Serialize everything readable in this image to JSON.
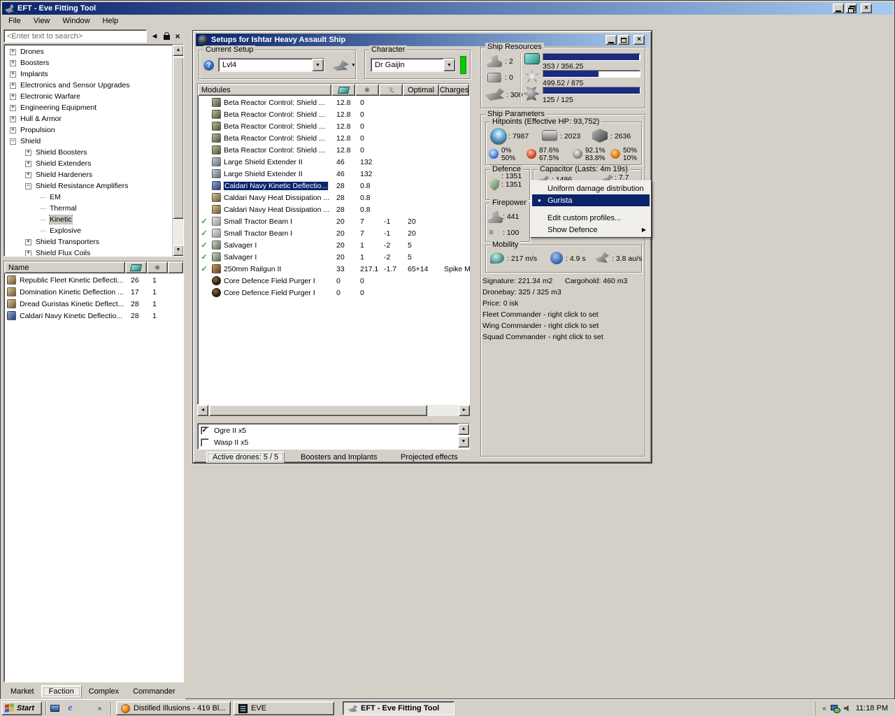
{
  "colors": {
    "title_gradient_start": "#0a246a",
    "title_gradient_end": "#a6caf0",
    "selection": "#0a246a",
    "window_face": "#d4d0c8",
    "mdi_background": "#868686",
    "progress_bar": "#1b2c7e",
    "check_green": "#2f9e2f",
    "character_bar_green": "#00cc00"
  },
  "app": {
    "title": "EFT - Eve Fitting Tool",
    "menu": [
      "File",
      "View",
      "Window",
      "Help"
    ],
    "search_placeholder": "<Enter text to search>"
  },
  "tree": [
    {
      "label": "Drones",
      "glyph": "+",
      "level": 0
    },
    {
      "label": "Boosters",
      "glyph": "+",
      "level": 0
    },
    {
      "label": "Implants",
      "glyph": "+",
      "level": 0
    },
    {
      "label": "Electronics and Sensor Upgrades",
      "glyph": "+",
      "level": 0
    },
    {
      "label": "Electronic Warfare",
      "glyph": "+",
      "level": 0
    },
    {
      "label": "Engineering Equipment",
      "glyph": "+",
      "level": 0
    },
    {
      "label": "Hull & Armor",
      "glyph": "+",
      "level": 0
    },
    {
      "label": "Propulsion",
      "glyph": "+",
      "level": 0
    },
    {
      "label": "Shield",
      "glyph": "-",
      "level": 0
    },
    {
      "label": "Shield Boosters",
      "glyph": "+",
      "level": 1
    },
    {
      "label": "Shield Extenders",
      "glyph": "+",
      "level": 1
    },
    {
      "label": "Shield Hardeners",
      "glyph": "+",
      "level": 1
    },
    {
      "label": "Shield Resistance Amplifiers",
      "glyph": "-",
      "level": 1
    },
    {
      "label": "EM",
      "glyph": "",
      "level": 2
    },
    {
      "label": "Thermal",
      "glyph": "",
      "level": 2
    },
    {
      "label": "Kinetic",
      "glyph": "",
      "level": 2,
      "selected": true
    },
    {
      "label": "Explosive",
      "glyph": "",
      "level": 2
    },
    {
      "label": "Shield Transporters",
      "glyph": "+",
      "level": 1
    },
    {
      "label": "Shield Flux Coils",
      "glyph": "+",
      "level": 1
    }
  ],
  "browser": {
    "name_header": "Name",
    "rows": [
      {
        "name": "Republic Fleet Kinetic Deflecti...",
        "cpu": "26",
        "pg": "1",
        "icon": "module-brown"
      },
      {
        "name": "Domination Kinetic Deflection ...",
        "cpu": "17",
        "pg": "1",
        "icon": "module-brown"
      },
      {
        "name": "Dread Guristas Kinetic Deflect...",
        "cpu": "28",
        "pg": "1",
        "icon": "module-brown"
      },
      {
        "name": "Caldari Navy Kinetic Deflectio...",
        "cpu": "28",
        "pg": "1",
        "icon": "module-blue"
      }
    ]
  },
  "left_tabs": [
    {
      "label": "Market"
    },
    {
      "label": "Faction",
      "selected": true
    },
    {
      "label": "Complex"
    },
    {
      "label": "Commander"
    }
  ],
  "setups": {
    "title": "Setups for Ishtar Heavy Assault Ship",
    "current_setup_label": "Current Setup",
    "current_setup_value": "Lvl4",
    "character_label": "Character",
    "character_value": "Dr Gaijin",
    "columns": {
      "modules": "Modules",
      "optimal": "Optimal",
      "charges": "Charges"
    },
    "modules": [
      {
        "name": "Beta Reactor Control: Shield ...",
        "cpu": "12.8",
        "pg": "0",
        "icon": "reactor"
      },
      {
        "name": "Beta Reactor Control: Shield ...",
        "cpu": "12.8",
        "pg": "0",
        "icon": "reactor"
      },
      {
        "name": "Beta Reactor Control: Shield ...",
        "cpu": "12.8",
        "pg": "0",
        "icon": "reactor"
      },
      {
        "name": "Beta Reactor Control: Shield ...",
        "cpu": "12.8",
        "pg": "0",
        "icon": "reactor"
      },
      {
        "name": "Beta Reactor Control: Shield ...",
        "cpu": "12.8",
        "pg": "0",
        "icon": "reactor"
      },
      {
        "name": "Large Shield Extender II",
        "cpu": "46",
        "pg": "132",
        "icon": "extender"
      },
      {
        "name": "Large Shield Extender II",
        "cpu": "46",
        "pg": "132",
        "icon": "extender"
      },
      {
        "name": "Caldari Navy Kinetic Deflectio...",
        "cpu": "28",
        "pg": "0.8",
        "icon": "hardener-blue",
        "selected": true
      },
      {
        "name": "Caldari Navy Heat Dissipation ...",
        "cpu": "28",
        "pg": "0.8",
        "icon": "hardener-tan"
      },
      {
        "name": "Caldari Navy Heat Dissipation ...",
        "cpu": "28",
        "pg": "0.8",
        "icon": "hardener-tan"
      },
      {
        "name": "Small Tractor Beam I",
        "cpu": "20",
        "pg": "7",
        "cap": "-1",
        "optimal": "20",
        "icon": "tractor",
        "check": true
      },
      {
        "name": "Small Tractor Beam I",
        "cpu": "20",
        "pg": "7",
        "cap": "-1",
        "optimal": "20",
        "icon": "tractor",
        "check": true
      },
      {
        "name": "Salvager I",
        "cpu": "20",
        "pg": "1",
        "cap": "-2",
        "optimal": "5",
        "icon": "salvager",
        "check": true
      },
      {
        "name": "Salvager I",
        "cpu": "20",
        "pg": "1",
        "cap": "-2",
        "optimal": "5",
        "icon": "salvager",
        "check": true
      },
      {
        "name": "250mm Railgun II",
        "cpu": "33",
        "pg": "217.1",
        "cap": "-1.7",
        "optimal": "65+14",
        "charges": "Spike M",
        "icon": "railgun",
        "check": true
      },
      {
        "name": "Core Defence Field Purger I",
        "cpu": "0",
        "pg": "0",
        "icon": "rig"
      },
      {
        "name": "Core Defence Field Purger I",
        "cpu": "0",
        "pg": "0",
        "icon": "rig"
      }
    ],
    "drones": [
      {
        "label": "Ogre II x5",
        "checked": true
      },
      {
        "label": "Wasp II x5",
        "checked": false
      }
    ],
    "bottom_tabs": [
      {
        "label": "Active drones: 5 / 5",
        "selected": true
      },
      {
        "label": "Boosters and Implants"
      },
      {
        "label": "Projected effects"
      }
    ]
  },
  "resources": {
    "group_label": "Ship Resources",
    "turrets": ": 2",
    "launchers": ": 0",
    "calibration": ": 300",
    "cpu": {
      "text": "353 / 356.25",
      "pct": 99
    },
    "powergrid": {
      "text": "499.52 / 875",
      "pct": 57
    },
    "drone_bandwidth": {
      "text": "125 / 125",
      "pct": 100
    }
  },
  "parameters": {
    "group_label": "Ship Parameters",
    "hitpoints_label": "Hitpoints (Effective HP: 93,752)",
    "shield_hp": ": 7987",
    "armor_hp": ": 2023",
    "structure_hp": ": 2636",
    "resists": {
      "em": {
        "top": "0%",
        "bottom": "50%"
      },
      "thermal": {
        "top": "87.6%",
        "bottom": "67.5%"
      },
      "kinetic": {
        "top": "92.1%",
        "bottom": "83.8%"
      },
      "explosive": {
        "top": "50%",
        "bottom": "10%"
      }
    },
    "defence_label": "Defence",
    "defence_line1": ": 1351",
    "defence_line2": ": 1351",
    "capacitor_label": "Capacitor (Lasts: 4m 19s)",
    "capacitor_amount": ": 1486",
    "capacitor_rate": ": 7.7",
    "firepower_label": "Firepower",
    "volley": ": 441",
    "dps": ": 100",
    "mobility_label": "Mobility",
    "speed": ": 217 m/s",
    "agility": ": 4.9 s",
    "warp_speed": ": 3.8 au/s",
    "signature": "Signature: 221.34 m2",
    "cargohold": "Cargohold: 460 m3",
    "dronebay": "Dronebay: 325 / 325 m3",
    "price": "Price: 0 isk",
    "fleet_commander": "Fleet Commander - right click to set",
    "wing_commander": "Wing Commander - right click to set",
    "squad_commander": "Squad Commander - right click to set"
  },
  "context_menu": {
    "items": [
      {
        "label": "Uniform damage distribution"
      },
      {
        "label": "Gurista",
        "selected": true,
        "bullet": true
      },
      {
        "separator": true
      },
      {
        "label": "Edit custom profiles..."
      },
      {
        "label": "Show Defence",
        "submenu": true
      }
    ]
  },
  "taskbar": {
    "start_label": "Start",
    "tasks": [
      {
        "label": "Distilled Illusions - 419 Bl...",
        "icon": "firefox"
      },
      {
        "label": "EVE",
        "icon": "eve"
      },
      {
        "label": "EFT - Eve Fitting Tool",
        "icon": "eft",
        "active": true
      }
    ],
    "clock": "11:18 PM"
  }
}
